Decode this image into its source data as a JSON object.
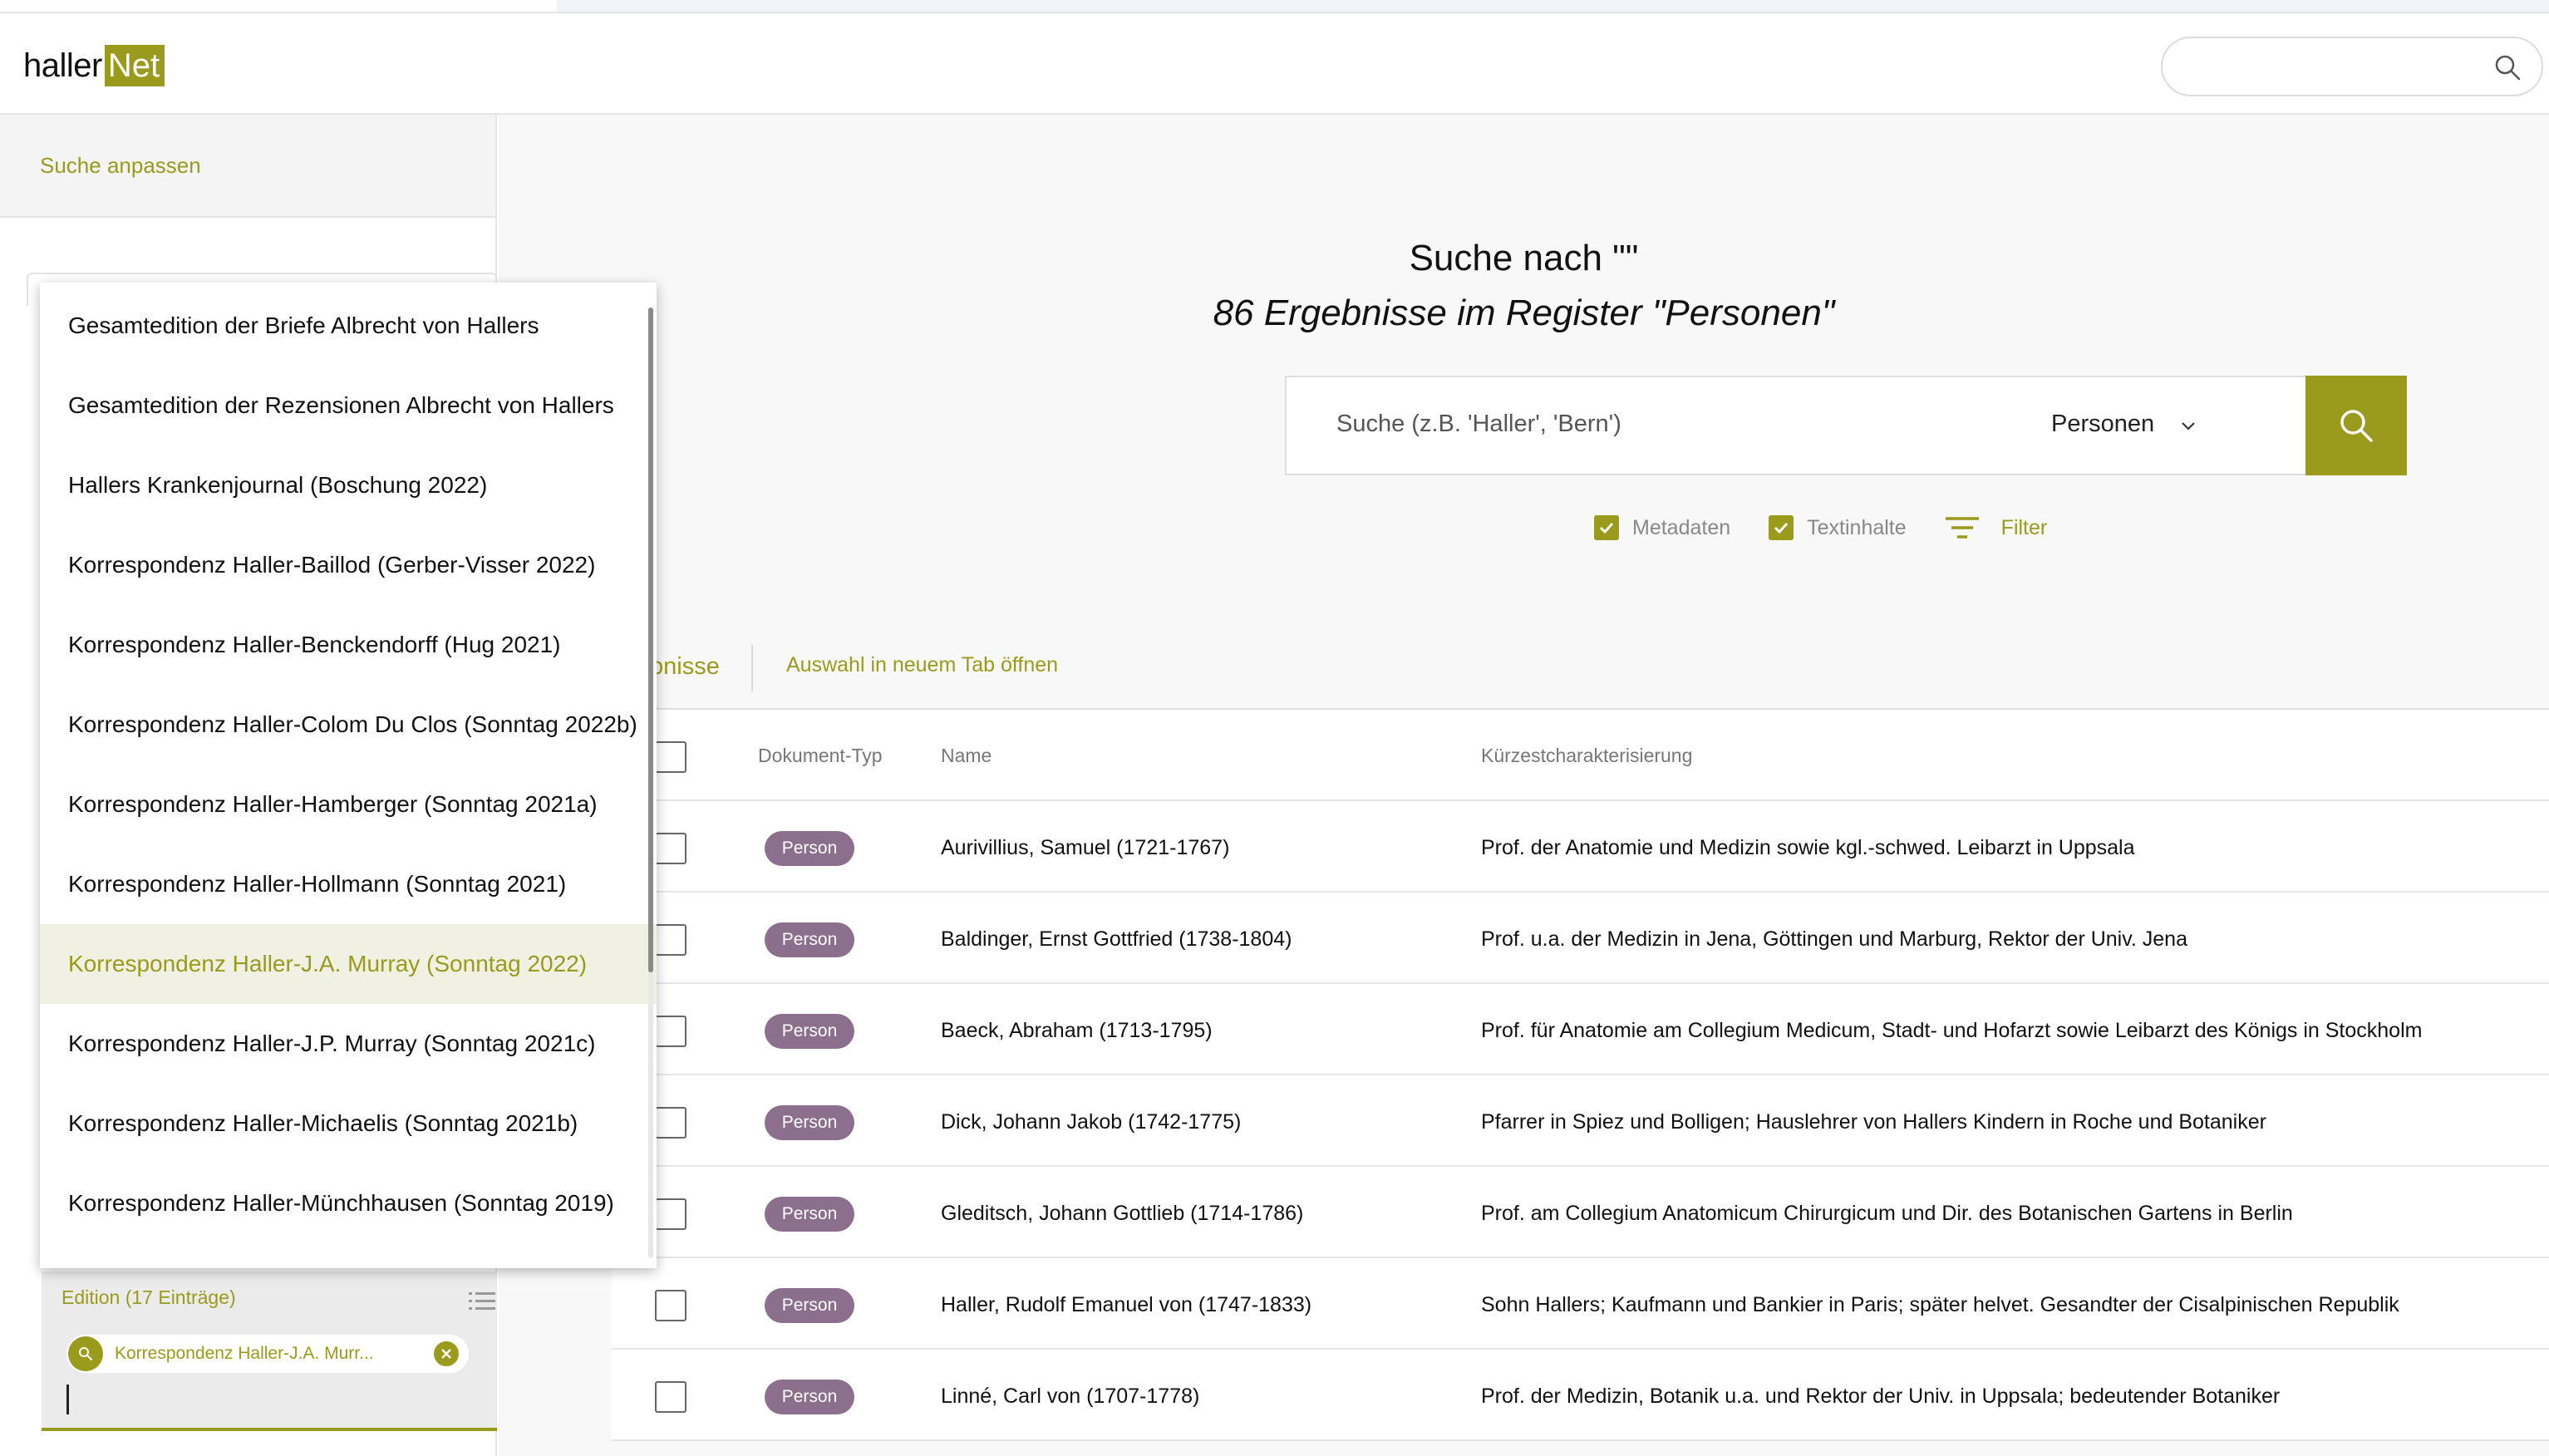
{
  "header": {
    "logo_part1": "haller",
    "logo_part2": "Net",
    "global_search_placeholder": ""
  },
  "sidebar": {
    "heading": "Suche anpassen"
  },
  "main": {
    "title": "Suche nach \"\"",
    "subtitle": "86 Ergebnisse im Register \"Personen\"",
    "search": {
      "placeholder": "Suche (z.B. 'Haller', 'Bern')",
      "register": "Personen"
    },
    "options": {
      "metadaten": "Metadaten",
      "textinhalte": "Textinhalte",
      "filter": "Filter"
    },
    "tabs": {
      "results": "bnisse",
      "open_tab": "Auswahl in neuem Tab öffnen"
    },
    "table": {
      "headers": [
        "Dokument-Typ",
        "Name",
        "Kürzestcharakterisierung"
      ],
      "rows": [
        {
          "type": "Person",
          "name": "Aurivillius, Samuel (1721-1767)",
          "desc": "Prof. der Anatomie und Medizin sowie kgl.-schwed. Leibarzt in Uppsala"
        },
        {
          "type": "Person",
          "name": "Baldinger, Ernst Gottfried (1738-1804)",
          "desc": "Prof. u.a. der Medizin in Jena, Göttingen und Marburg, Rektor der Univ. Jena"
        },
        {
          "type": "Person",
          "name": "Baeck, Abraham (1713-1795)",
          "desc": "Prof. für Anatomie am Collegium Medicum, Stadt- und Hofarzt sowie Leibarzt des Königs in Stockholm"
        },
        {
          "type": "Person",
          "name": "Dick, Johann Jakob (1742-1775)",
          "desc": "Pfarrer in Spiez und Bolligen; Hauslehrer von Hallers Kindern in Roche und Botaniker"
        },
        {
          "type": "Person",
          "name": "Gleditsch, Johann Gottlieb (1714-1786)",
          "desc": "Prof. am Collegium Anatomicum Chirurgicum und Dir. des Botanischen Gartens in Berlin"
        },
        {
          "type": "Person",
          "name": "Haller, Rudolf Emanuel von (1747-1833)",
          "desc": "Sohn Hallers; Kaufmann und Bankier in Paris; später helvet. Gesandter der Cisalpinischen Republik"
        },
        {
          "type": "Person",
          "name": "Linné, Carl von (1707-1778)",
          "desc": "Prof. der Medizin, Botanik u.a. und Rektor der Univ. in Uppsala; bedeutender Botaniker"
        }
      ]
    }
  },
  "dropdown": {
    "options": [
      "Gesamtedition der Briefe Albrecht von Hallers",
      "Gesamtedition der Rezensionen Albrecht von Hallers",
      "Hallers Krankenjournal (Boschung 2022)",
      "Korrespondenz Haller-Baillod (Gerber-Visser 2022)",
      "Korrespondenz Haller-Benckendorff (Hug 2021)",
      "Korrespondenz Haller-Colom Du Clos (Sonntag 2022b)",
      "Korrespondenz Haller-Hamberger (Sonntag 2021a)",
      "Korrespondenz Haller-Hollmann (Sonntag 2021)",
      "Korrespondenz Haller-J.A. Murray (Sonntag 2022)",
      "Korrespondenz Haller-J.P. Murray (Sonntag 2021c)",
      "Korrespondenz Haller-Michaelis (Sonntag 2021b)",
      "Korrespondenz Haller-Münchhausen (Sonntag 2019)"
    ],
    "active_index": 8
  },
  "edition": {
    "label": "Edition (17 Einträge)",
    "chip": "Korrespondenz Haller-J.A. Murr..."
  },
  "colors": {
    "accent": "#9a9a1c",
    "badge": "#8b6f8c"
  }
}
